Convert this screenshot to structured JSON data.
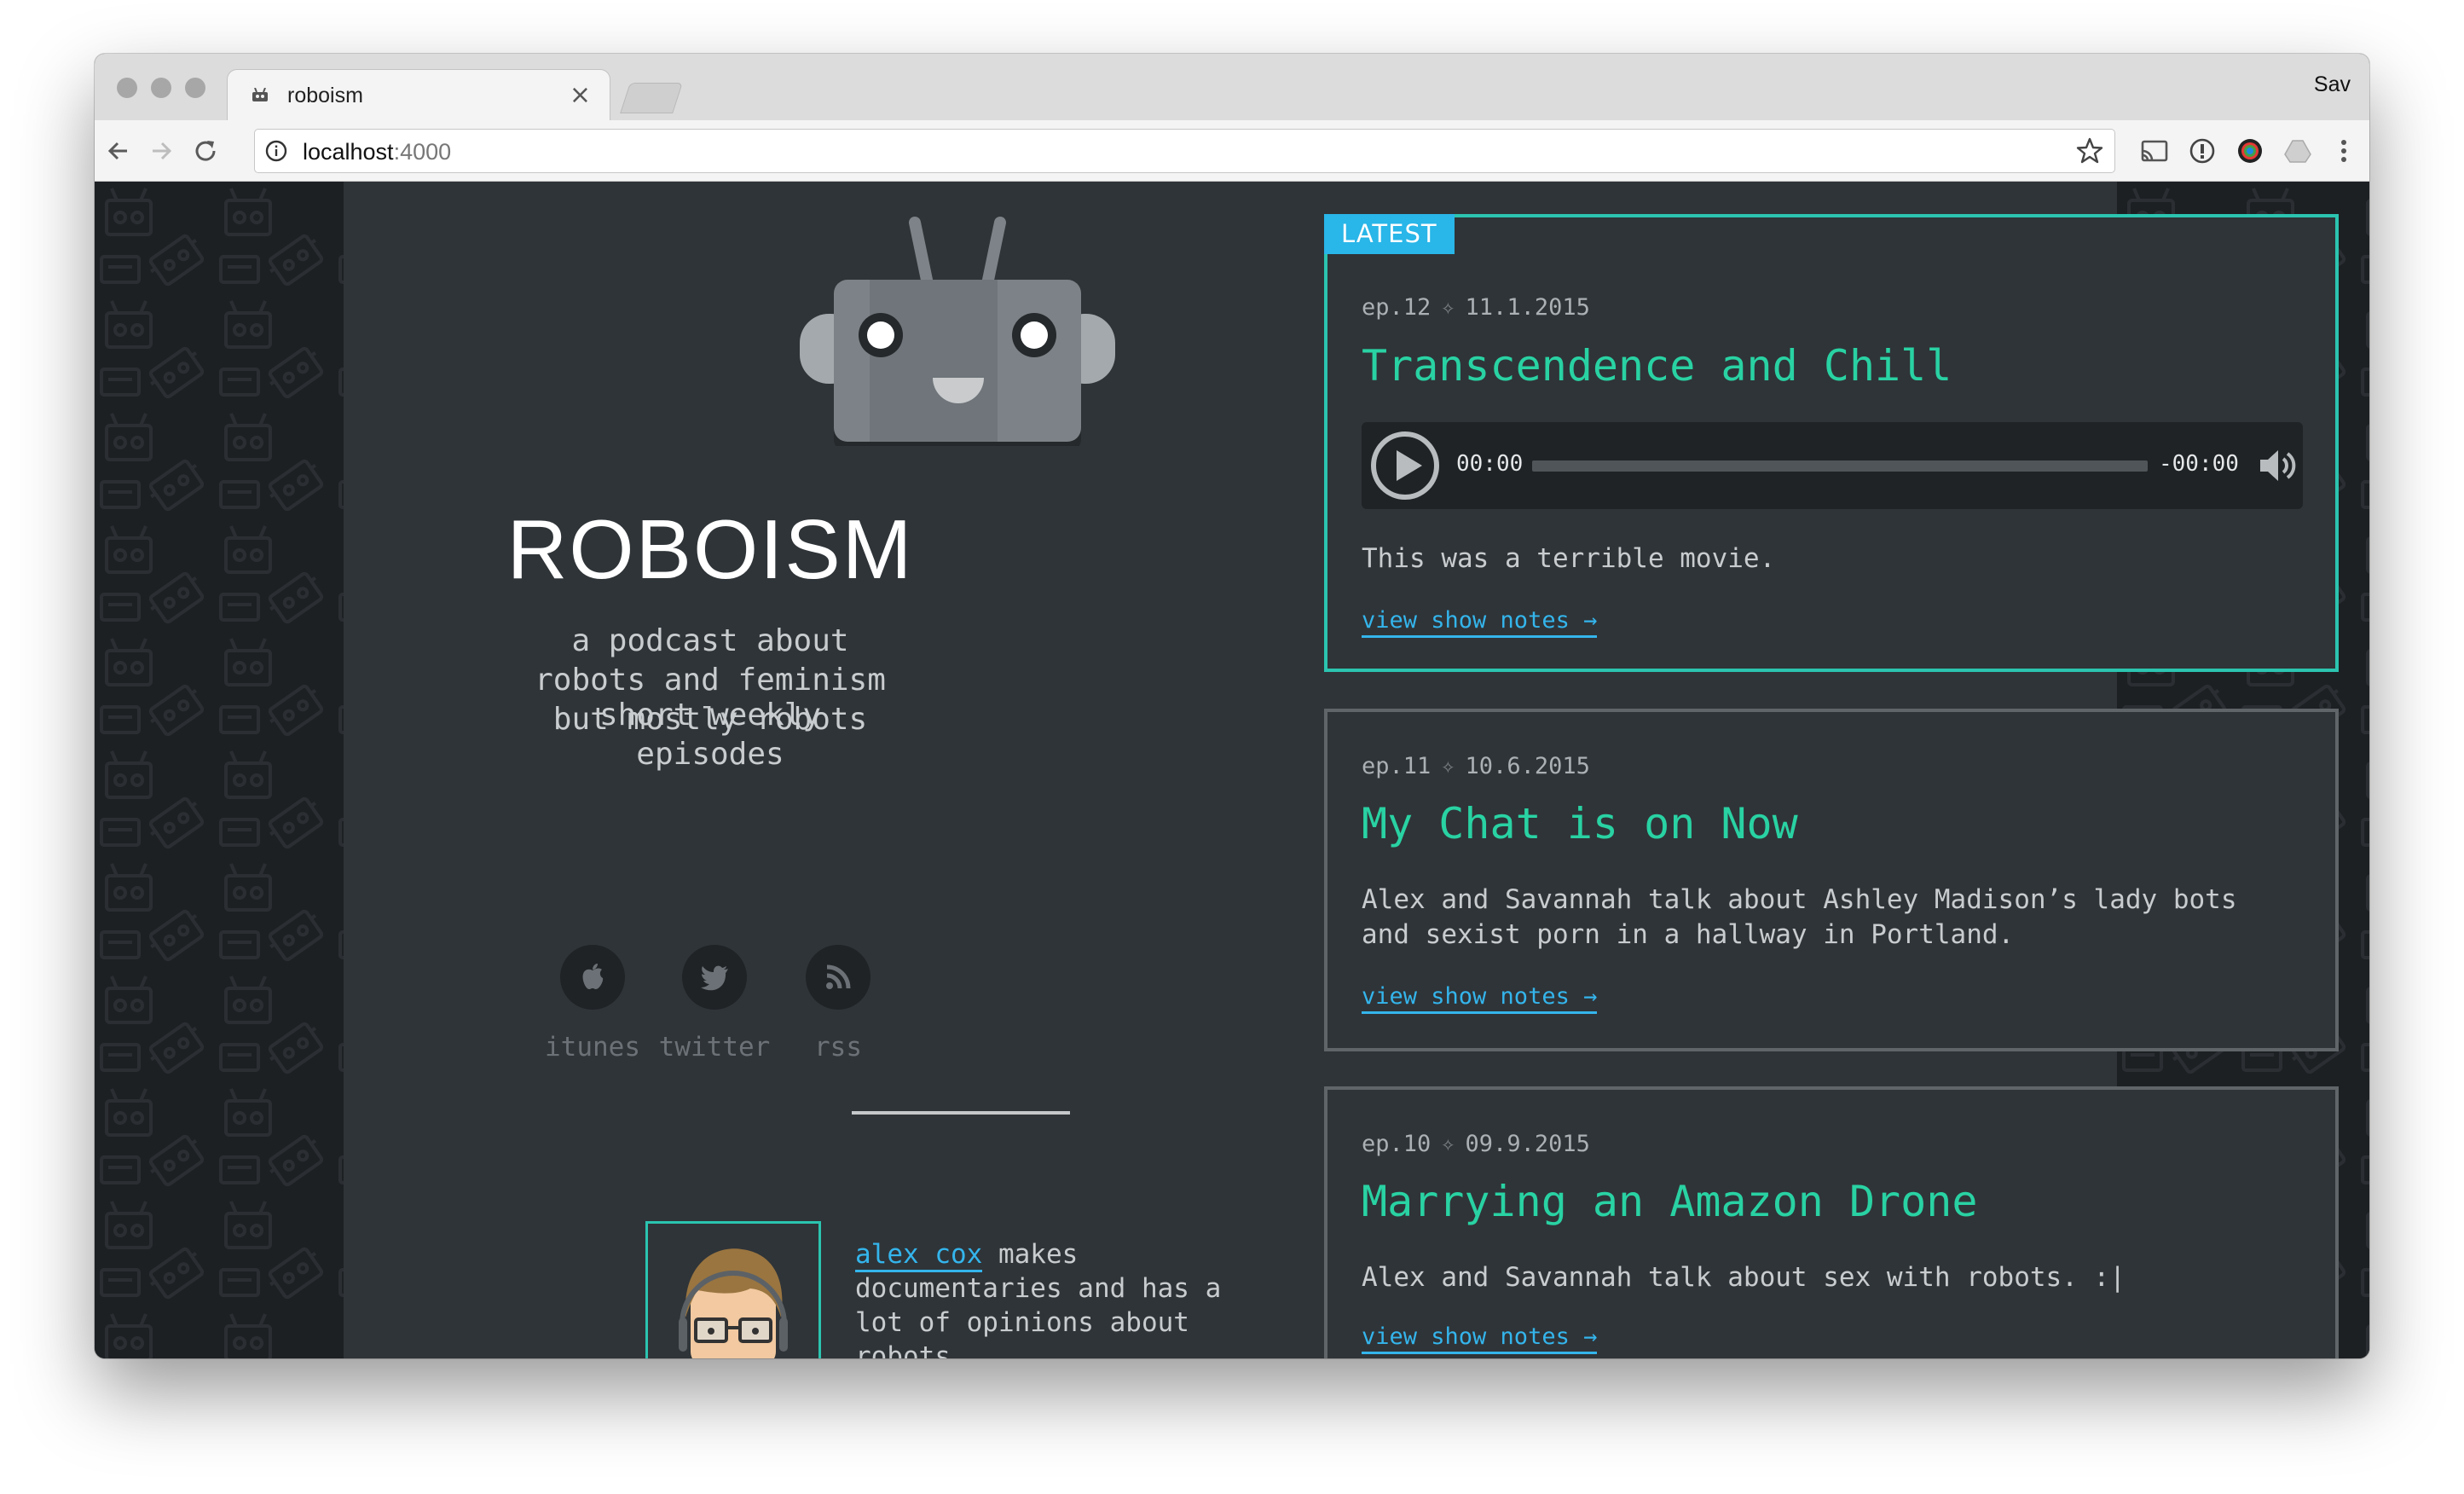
{
  "browser": {
    "tab_title": "roboism",
    "tab_close": "×",
    "profile_name": "Sav",
    "url_host": "localhost",
    "url_port": ":4000"
  },
  "site": {
    "title": "ROBOISM",
    "tagline": [
      "a podcast about",
      "robots and feminism",
      "but mostly robots"
    ],
    "schedule": [
      "short weekly",
      "episodes"
    ],
    "social": [
      {
        "label": "itunes",
        "icon": "apple-icon"
      },
      {
        "label": "twitter",
        "icon": "twitter-icon"
      },
      {
        "label": "rss",
        "icon": "rss-icon"
      }
    ],
    "host": {
      "name": "alex cox",
      "bio": " makes documentaries and has a lot of opinions about robots"
    }
  },
  "episodes": [
    {
      "badge": "LATEST",
      "number": "ep.12",
      "separator": "✧",
      "date": "11.1.2015",
      "title": "Transcendence and Chill",
      "player": {
        "current": "00:00",
        "remaining": "-00:00"
      },
      "description": "This was a terrible movie.",
      "link": "view show notes →"
    },
    {
      "number": "ep.11",
      "separator": "✧",
      "date": "10.6.2015",
      "title": "My Chat is on Now",
      "description": "Alex and Savannah talk about Ashley Madison’s lady bots and sexist porn in a hallway in Portland.",
      "link": "view show notes →"
    },
    {
      "number": "ep.10",
      "separator": "✧",
      "date": "09.9.2015",
      "title": "Marrying an Amazon Drone",
      "description": "Alex and Savannah talk about sex with robots. :|",
      "link": "view show notes →"
    }
  ],
  "colors": {
    "accent_teal": "#2bc4b0",
    "title_green": "#29d2a3",
    "link_blue": "#34b5ec",
    "badge_blue": "#29b6e8",
    "panel": "#2f3438",
    "background": "#1d2023"
  }
}
